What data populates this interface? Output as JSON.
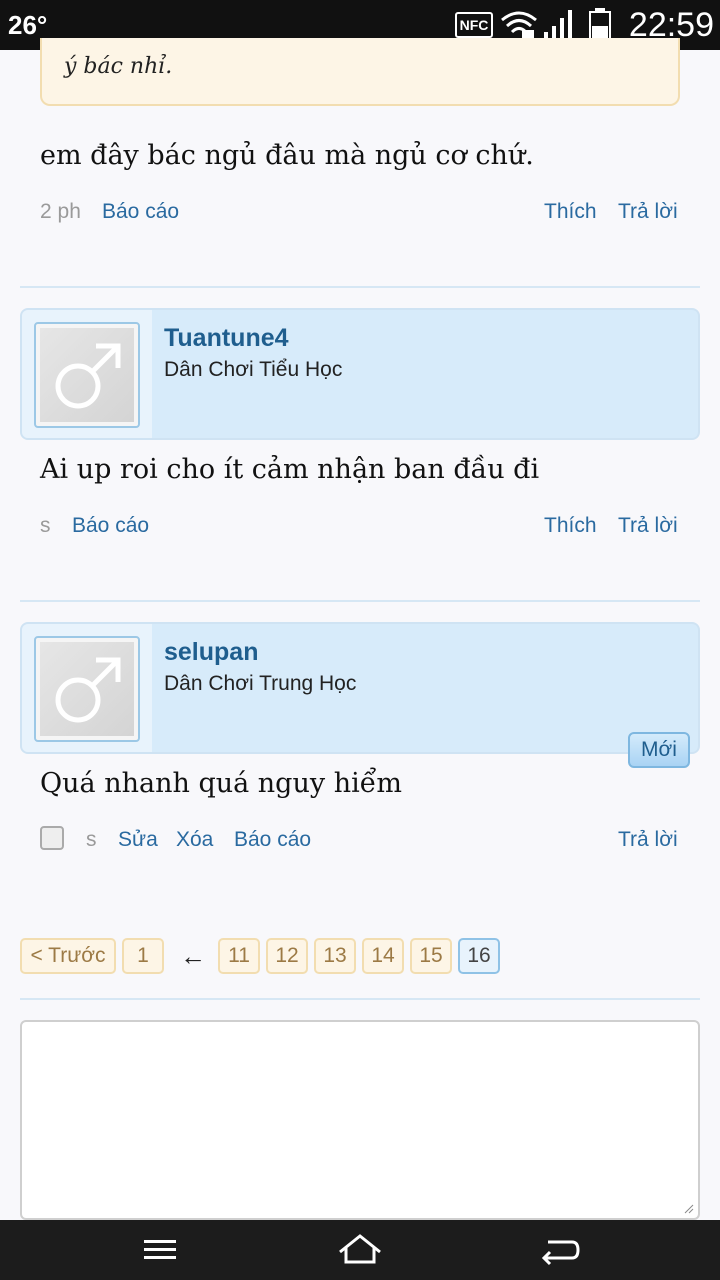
{
  "status_bar": {
    "temperature": "26°",
    "nfc_label": "NFC",
    "time": "22:59"
  },
  "quote": {
    "text": "ý bác nhỉ."
  },
  "post1": {
    "body": "em đây bác ngủ đâu mà ngủ cơ chứ.",
    "time": "2 ph",
    "report": "Báo cáo",
    "like": "Thích",
    "reply": "Trả lời"
  },
  "post2": {
    "username": "Tuantune4",
    "rank": "Dân Chơi Tiểu Học",
    "body": "Ai up roi cho ít cảm nhận ban đầu đi",
    "time": "s",
    "report": "Báo cáo",
    "like": "Thích",
    "reply": "Trả lời"
  },
  "post3": {
    "username": "selupan",
    "rank": "Dân Chơi Trung Học",
    "badge": "Mới",
    "body": "Quá nhanh quá nguy hiểm",
    "time": "s",
    "edit": "Sửa",
    "delete": "Xóa",
    "report": "Báo cáo",
    "reply": "Trả lời"
  },
  "pagination": {
    "prev": "< Trước",
    "pages": [
      "1",
      "11",
      "12",
      "13",
      "14",
      "15",
      "16"
    ],
    "current": "16",
    "jump_arrow": "←"
  },
  "colors": {
    "link": "#2a6aa0",
    "username": "#1f5e8e",
    "card_bg": "#d7ebfa",
    "pager_bg": "#fdf5e6"
  }
}
